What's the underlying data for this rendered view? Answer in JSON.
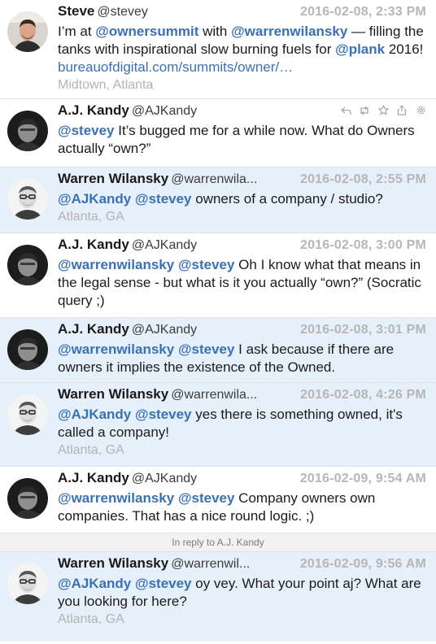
{
  "tweets": [
    {
      "name": "Steve",
      "handle": "@stevey",
      "time": "2016-02-08, 2:33 PM",
      "segments": [
        {
          "t": "I’m at ",
          "k": "text"
        },
        {
          "t": "@ownersummit",
          "k": "mention"
        },
        {
          "t": " with ",
          "k": "text"
        },
        {
          "t": "@warrenwilansky",
          "k": "mention"
        },
        {
          "t": " — filling the tanks with inspirational slow burning fuels for ",
          "k": "text"
        },
        {
          "t": "@plank",
          "k": "mention"
        },
        {
          "t": " 2016! ",
          "k": "text"
        },
        {
          "t": "bureauofdigital.com/summits/owner/…",
          "k": "link"
        }
      ],
      "location": "Midtown, Atlanta",
      "avatar": "steve",
      "highlight": false
    },
    {
      "name": "A.J. Kandy",
      "handle": "@AJKandy",
      "time": "",
      "segments": [
        {
          "t": "@stevey",
          "k": "mention"
        },
        {
          "t": " It’s bugged me for a while now. What do Owners actually “own?”",
          "k": "text"
        }
      ],
      "location": "",
      "avatar": "aj",
      "highlight": false,
      "actions": [
        "reply-icon",
        "retweet-icon",
        "star-icon",
        "share-icon",
        "gear-icon"
      ]
    },
    {
      "name": "Warren Wilansky",
      "handle": "@warrenwila...",
      "time": "2016-02-08, 2:55 PM",
      "segments": [
        {
          "t": "@AJKandy",
          "k": "mention"
        },
        {
          "t": " ",
          "k": "text"
        },
        {
          "t": "@stevey",
          "k": "mention"
        },
        {
          "t": " owners of a company / studio?",
          "k": "text"
        }
      ],
      "location": "Atlanta, GA",
      "avatar": "warren",
      "highlight": true
    },
    {
      "name": "A.J. Kandy",
      "handle": "@AJKandy",
      "time": "2016-02-08, 3:00 PM",
      "segments": [
        {
          "t": "@warrenwilansky",
          "k": "mention"
        },
        {
          "t": " ",
          "k": "text"
        },
        {
          "t": "@stevey",
          "k": "mention"
        },
        {
          "t": " Oh I know what that means in the legal sense - but what is it you actually “own?” (Socratic query ;)",
          "k": "text"
        }
      ],
      "location": "",
      "avatar": "aj",
      "highlight": false
    },
    {
      "name": "A.J. Kandy",
      "handle": "@AJKandy",
      "time": "2016-02-08, 3:01 PM",
      "segments": [
        {
          "t": "@warrenwilansky",
          "k": "mention"
        },
        {
          "t": " ",
          "k": "text"
        },
        {
          "t": "@stevey",
          "k": "mention"
        },
        {
          "t": " I ask because if there are owners it implies the existence of the Owned.",
          "k": "text"
        }
      ],
      "location": "",
      "avatar": "aj",
      "highlight": true
    },
    {
      "name": "Warren Wilansky",
      "handle": "@warrenwila...",
      "time": "2016-02-08, 4:26 PM",
      "segments": [
        {
          "t": "@AJKandy",
          "k": "mention"
        },
        {
          "t": " ",
          "k": "text"
        },
        {
          "t": "@stevey",
          "k": "mention"
        },
        {
          "t": " yes there is something owned, it's called a company!",
          "k": "text"
        }
      ],
      "location": "Atlanta, GA",
      "avatar": "warren",
      "highlight": true
    },
    {
      "name": "A.J. Kandy",
      "handle": "@AJKandy",
      "time": "2016-02-09, 9:54 AM",
      "segments": [
        {
          "t": "@warrenwilansky",
          "k": "mention"
        },
        {
          "t": " ",
          "k": "text"
        },
        {
          "t": "@stevey",
          "k": "mention"
        },
        {
          "t": " Company owners own companies. That has a nice round logic. ;)",
          "k": "text"
        }
      ],
      "location": "",
      "avatar": "aj",
      "highlight": false
    }
  ],
  "reply_bar": "In reply to A.J. Kandy",
  "last_tweet": {
    "name": "Warren Wilansky",
    "handle": "@warrenwil...",
    "time": "2016-02-09, 9:56 AM",
    "segments": [
      {
        "t": "@AJKandy",
        "k": "mention"
      },
      {
        "t": " ",
        "k": "text"
      },
      {
        "t": "@stevey",
        "k": "mention"
      },
      {
        "t": " oy vey. What your point aj? What are you looking for here?",
        "k": "text"
      }
    ],
    "location": "Atlanta, GA",
    "avatar": "warren",
    "highlight": true
  },
  "colors": {
    "mention": "#3a71b5",
    "timestamp": "#b6b6b6",
    "highlight_row": "#e6f0fa",
    "location": "#b3b3b3"
  }
}
